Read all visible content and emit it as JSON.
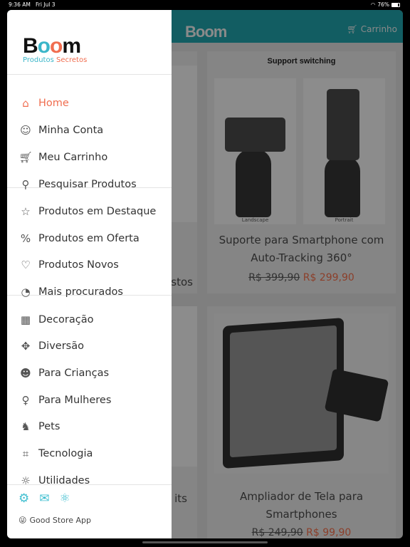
{
  "status": {
    "time": "9:36 AM",
    "date": "Fri Jul 3",
    "battery": "76%",
    "battery_level": 0.76
  },
  "header": {
    "logo": "Boom",
    "cart_label": "Carrinho"
  },
  "drawer": {
    "logo": {
      "word": "Boom",
      "tagline_a": "Produtos",
      "tagline_b": "Secretos"
    },
    "groups": [
      [
        {
          "label": "Home",
          "icon": "home-icon",
          "active": true
        },
        {
          "label": "Minha Conta",
          "icon": "user-icon"
        },
        {
          "label": "Meu Carrinho",
          "icon": "cart-icon"
        },
        {
          "label": "Pesquisar Produtos",
          "icon": "search-icon"
        }
      ],
      [
        {
          "label": "Produtos em Destaque",
          "icon": "star-icon"
        },
        {
          "label": "Produtos em Oferta",
          "icon": "percent-icon"
        },
        {
          "label": "Produtos Novos",
          "icon": "heart-icon"
        },
        {
          "label": "Mais procurados",
          "icon": "trending-icon"
        }
      ],
      [
        {
          "label": "Decoração",
          "icon": "house-icon"
        },
        {
          "label": "Diversão",
          "icon": "gamepad-icon"
        },
        {
          "label": "Para Crianças",
          "icon": "baby-icon"
        },
        {
          "label": "Para Mulheres",
          "icon": "woman-icon"
        },
        {
          "label": "Pets",
          "icon": "dog-icon"
        },
        {
          "label": "Tecnologia",
          "icon": "remote-icon"
        },
        {
          "label": "Utilidades",
          "icon": "lightbulb-icon"
        }
      ]
    ],
    "footer_icons": [
      "gear-icon",
      "mail-icon",
      "react-icon"
    ],
    "footer_text": "Good Store App"
  },
  "products": [
    {
      "image_caption": "Support switching",
      "sub_captions": [
        "Landscape",
        "Portrait"
      ],
      "title": "Suporte para Smartphone com Auto-Tracking 360°",
      "old_price": "R$ 399,90",
      "price": "R$ 299,90"
    },
    {
      "title": "Ampliador de Tela para Smartphones",
      "old_price": "R$ 249,90",
      "price": "R$ 99,90"
    }
  ],
  "partial": {
    "title1_fragment": "stos",
    "title2_fragment": "its"
  }
}
